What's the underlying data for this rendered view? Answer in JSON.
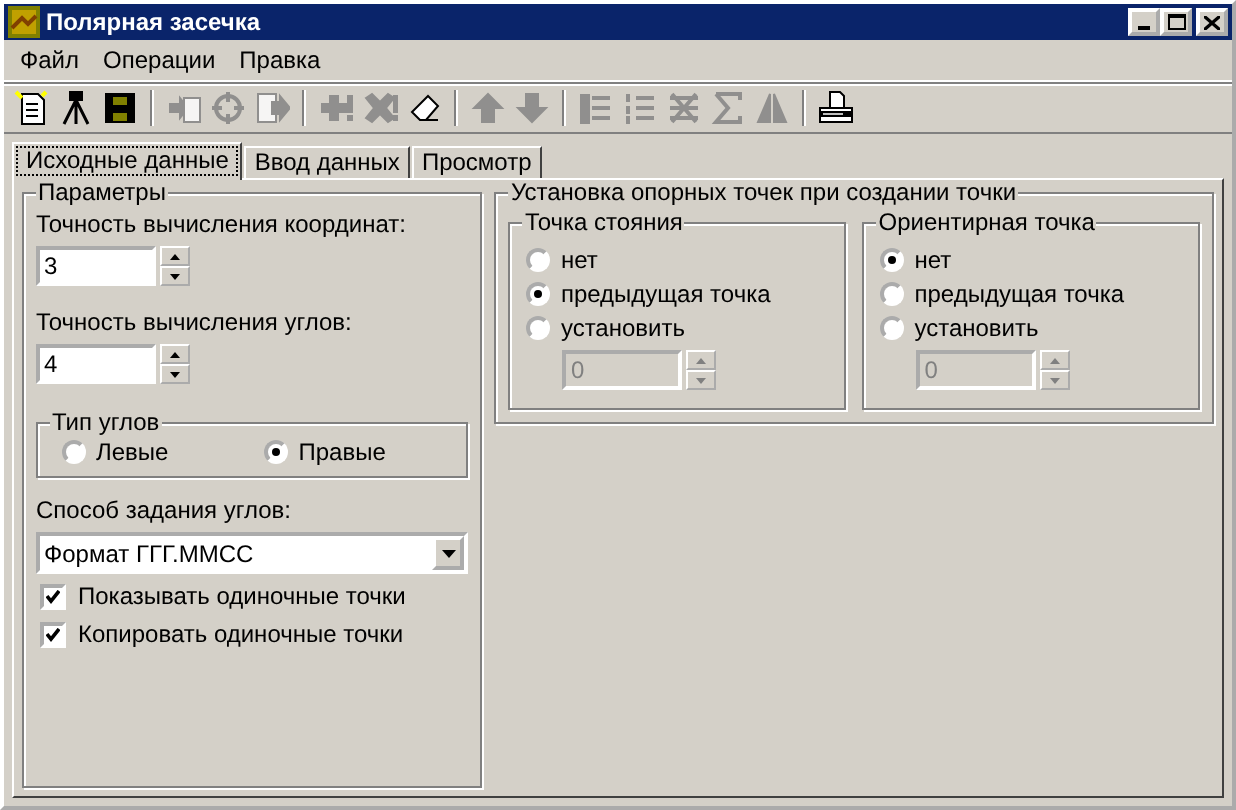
{
  "window": {
    "title": "Полярная засечка"
  },
  "menu": [
    {
      "label": "Файл"
    },
    {
      "label": "Операции"
    },
    {
      "label": "Правка"
    }
  ],
  "toolbar": [
    {
      "kind": "new",
      "disabled": false
    },
    {
      "kind": "tripod",
      "disabled": false
    },
    {
      "kind": "save",
      "disabled": false
    },
    {
      "kind": "separator"
    },
    {
      "kind": "add",
      "disabled": true
    },
    {
      "kind": "target",
      "disabled": true
    },
    {
      "kind": "export",
      "disabled": true
    },
    {
      "kind": "separator"
    },
    {
      "kind": "plus",
      "disabled": true
    },
    {
      "kind": "cross",
      "disabled": true
    },
    {
      "kind": "eraser",
      "disabled": false
    },
    {
      "kind": "separator"
    },
    {
      "kind": "up",
      "disabled": true
    },
    {
      "kind": "down",
      "disabled": true
    },
    {
      "kind": "separator"
    },
    {
      "kind": "list",
      "disabled": true
    },
    {
      "kind": "numbered",
      "disabled": true
    },
    {
      "kind": "grid",
      "disabled": true
    },
    {
      "kind": "sigma",
      "disabled": true
    },
    {
      "kind": "mirror",
      "disabled": true
    },
    {
      "kind": "separator"
    },
    {
      "kind": "printer",
      "disabled": false
    }
  ],
  "tabs": [
    {
      "label": "Исходные данные",
      "selected": true
    },
    {
      "label": "Ввод данных",
      "selected": false
    },
    {
      "label": "Просмотр",
      "selected": false
    }
  ],
  "parameters": {
    "title": "Параметры",
    "coord_precision": {
      "label": "Точность вычисления координат:",
      "value": "3"
    },
    "angle_precision": {
      "label": "Точность вычисления углов:",
      "value": "4"
    },
    "angle_type": {
      "title": "Тип углов",
      "options": [
        {
          "label": "Левые",
          "selected": false
        },
        {
          "label": "Правые",
          "selected": true
        }
      ]
    },
    "angle_mode": {
      "label": "Способ задания углов:",
      "value": "Формат ГГГ.ММСС"
    },
    "options": [
      {
        "label": "Показывать одиночные точки",
        "checked": true
      },
      {
        "label": "Копировать одиночные точки",
        "checked": true
      }
    ]
  },
  "reference_points": {
    "title": "Установка опорных точек при создании точки",
    "groups": [
      {
        "title": "Точка стояния",
        "options": [
          {
            "label": "нет",
            "selected": false
          },
          {
            "label": "предыдущая точка",
            "selected": true
          },
          {
            "label": "установить",
            "selected": false
          }
        ],
        "field": {
          "value": "0",
          "disabled": true
        }
      },
      {
        "title": "Ориентирная точка",
        "options": [
          {
            "label": "нет",
            "selected": true
          },
          {
            "label": "предыдущая точка",
            "selected": false
          },
          {
            "label": "установить",
            "selected": false
          }
        ],
        "field": {
          "value": "0",
          "disabled": true
        }
      }
    ]
  }
}
